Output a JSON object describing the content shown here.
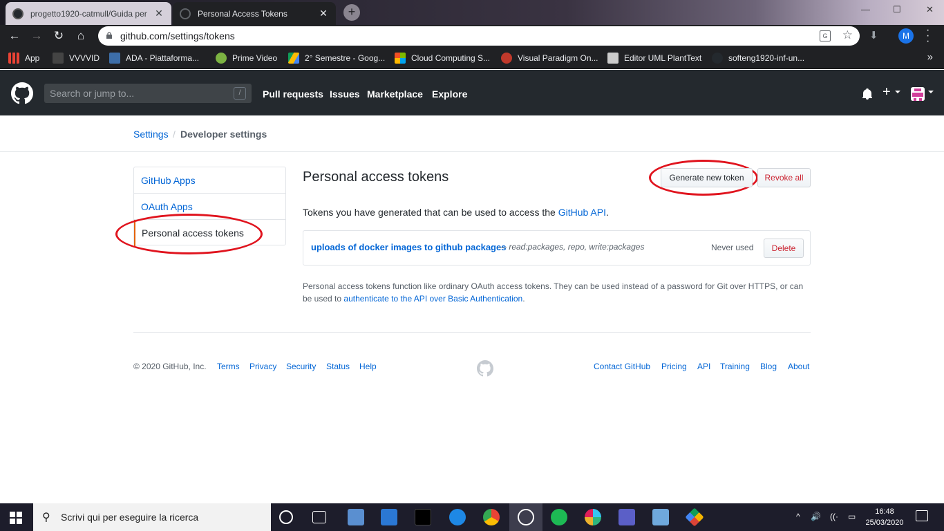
{
  "browser": {
    "tabs": [
      {
        "title": "progetto1920-catmull/Guida per"
      },
      {
        "title": "Personal Access Tokens"
      }
    ],
    "url": "github.com/settings/tokens",
    "profile_initial": "M",
    "bookmarks": [
      {
        "label": "App",
        "color": "#ea4335"
      },
      {
        "label": "VVVVID",
        "color": "#ffffff"
      },
      {
        "label": "ADA - Piattaforma...",
        "color": "#3d6ea8"
      },
      {
        "label": "Prime Video",
        "color": "#7cb342"
      },
      {
        "label": "2° Semestre - Goog...",
        "color": "#fbbc04"
      },
      {
        "label": "Cloud Computing S...",
        "color": "#f25022"
      },
      {
        "label": "Visual Paradigm On...",
        "color": "#c0392b"
      },
      {
        "label": "Editor UML PlantText",
        "color": "#cccccc"
      },
      {
        "label": "softeng1920-inf-un...",
        "color": "#24292e"
      }
    ]
  },
  "github": {
    "search_placeholder": "Search or jump to...",
    "search_key": "/",
    "nav": [
      "Pull requests",
      "Issues",
      "Marketplace",
      "Explore"
    ]
  },
  "breadcrumb": {
    "settings": "Settings",
    "sep": "/",
    "current": "Developer settings"
  },
  "sidebar": {
    "items": [
      {
        "label": "GitHub Apps"
      },
      {
        "label": "OAuth Apps"
      },
      {
        "label": "Personal access tokens"
      }
    ]
  },
  "main": {
    "title": "Personal access tokens",
    "generate_label": "Generate new token",
    "revoke_label": "Revoke all",
    "intro_text": "Tokens you have generated that can be used to access the",
    "intro_link": "GitHub API",
    "intro_end": ".",
    "token": {
      "name": "uploads of docker images to github packages",
      "scopes": "— read:packages, repo, write:packages",
      "last_used": "Never used",
      "delete_label": "Delete"
    },
    "note_text": "Personal access tokens function like ordinary OAuth access tokens. They can be used instead of a password for Git over HTTPS, or can be used to",
    "note_link": "authenticate to the API over Basic Authentication",
    "note_end": "."
  },
  "footer": {
    "copyright": "© 2020 GitHub, Inc.",
    "left_links": [
      "Terms",
      "Privacy",
      "Security",
      "Status",
      "Help"
    ],
    "right_links": [
      "Contact GitHub",
      "Pricing",
      "API",
      "Training",
      "Blog",
      "About"
    ]
  },
  "taskbar": {
    "search_placeholder": "Scrivi qui per eseguire la ricerca",
    "time": "16:48",
    "date": "25/03/2020"
  },
  "colors": {
    "link": "#0366d6",
    "annotation_ring": "#e0141e",
    "danger": "#cb2431",
    "header_bg": "#24292e"
  }
}
